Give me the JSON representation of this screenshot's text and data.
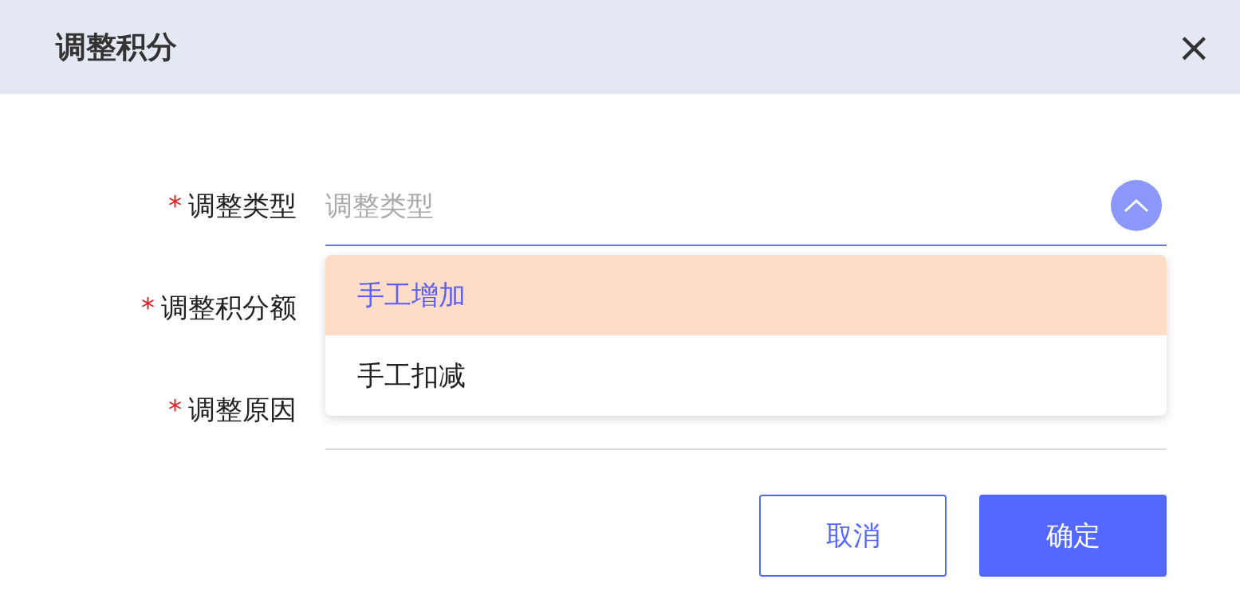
{
  "dialog": {
    "title": "调整积分",
    "close_label": "×"
  },
  "required_mark": "*",
  "fields": [
    {
      "label": "调整类型",
      "required": true,
      "kind": "select",
      "placeholder": "调整类型",
      "expanded": true
    },
    {
      "label": "调整积分额",
      "required": true,
      "kind": "input"
    },
    {
      "label": "调整原因",
      "required": true,
      "kind": "input"
    }
  ],
  "dropdown": {
    "options": [
      {
        "label": "手工增加",
        "selected": true
      },
      {
        "label": "手工扣减",
        "selected": false
      }
    ]
  },
  "buttons": [
    {
      "label": "取消",
      "kind": "secondary"
    },
    {
      "label": "确定",
      "kind": "primary"
    }
  ]
}
